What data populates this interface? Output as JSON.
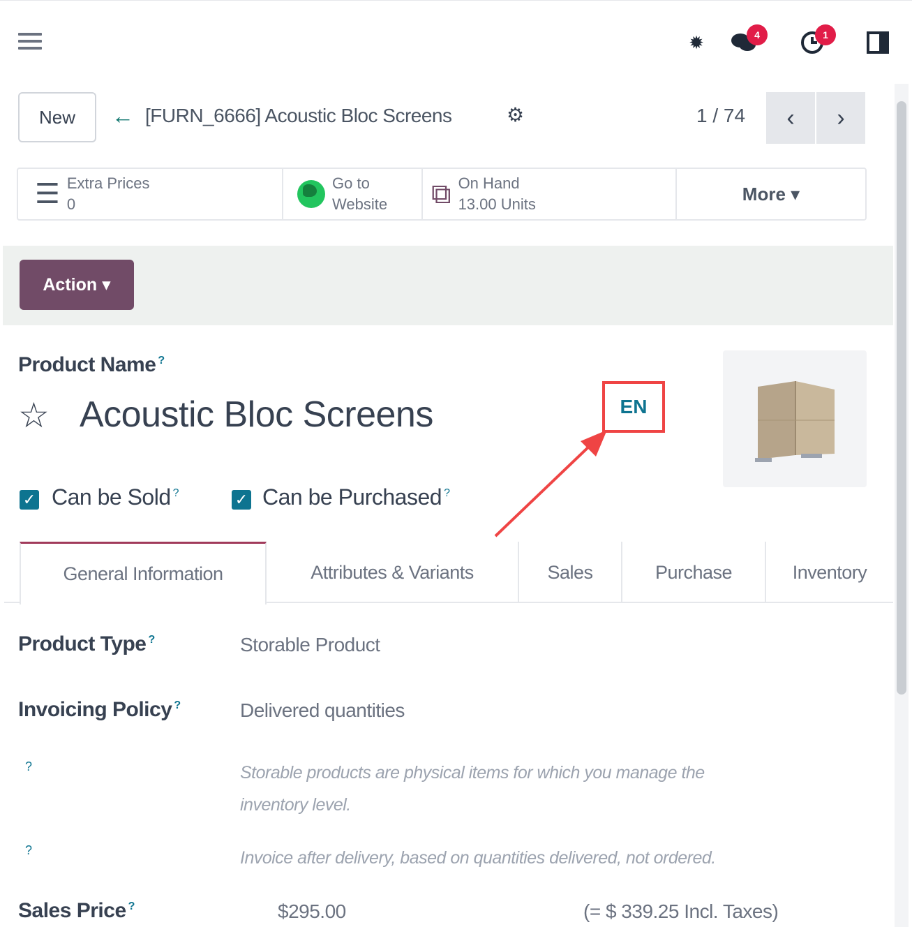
{
  "topbar": {
    "chat_badge": "4",
    "activity_badge": "1"
  },
  "control": {
    "new_label": "New",
    "breadcrumb": "[FURN_6666] Acoustic Bloc Screens",
    "pager": "1 / 74"
  },
  "smart_buttons": {
    "extra_prices_label": "Extra Prices",
    "extra_prices_value": "0",
    "website_line1": "Go to",
    "website_line2": "Website",
    "onhand_label": "On Hand",
    "onhand_value": "13.00 Units",
    "more_label": "More ▾"
  },
  "action": {
    "label": "Action ▾"
  },
  "form": {
    "product_name_label": "Product Name",
    "product_name": "Acoustic Bloc Screens",
    "lang": "EN",
    "can_be_sold": "Can be Sold",
    "can_be_purchased": "Can be Purchased"
  },
  "tabs": [
    "General Information",
    "Attributes & Variants",
    "Sales",
    "Purchase",
    "Inventory"
  ],
  "fields": {
    "product_type_label": "Product Type",
    "product_type_value": "Storable Product",
    "invoicing_label": "Invoicing Policy",
    "invoicing_value": "Delivered quantities",
    "help1_line1": "Storable products are physical items for which you manage the",
    "help1_line2": "inventory level.",
    "help2": "Invoice after delivery, based on quantities delivered, not ordered.",
    "sales_price_label": "Sales Price",
    "sales_price_value": "$295.00",
    "sales_price_incl": "(= $ 339.25 Incl. Taxes)"
  },
  "colors": {
    "brand": "#714b67",
    "accent": "#0e7490",
    "annotation": "#ef4444"
  }
}
